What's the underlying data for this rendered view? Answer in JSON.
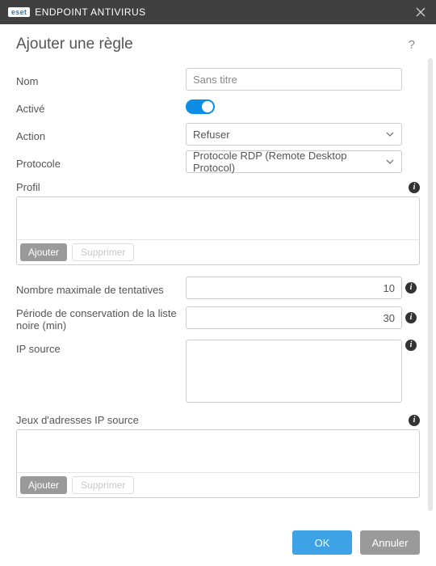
{
  "titlebar": {
    "brand": "eset",
    "title": "ENDPOINT ANTIVIRUS"
  },
  "header": {
    "page_title": "Ajouter une règle",
    "help_symbol": "?"
  },
  "form": {
    "name": {
      "label": "Nom",
      "placeholder": "Sans titre",
      "value": ""
    },
    "enabled": {
      "label": "Activé",
      "value": true
    },
    "action": {
      "label": "Action",
      "selected": "Refuser"
    },
    "protocol": {
      "label": "Protocole",
      "selected": "Protocole RDP (Remote Desktop Protocol)"
    },
    "profile": {
      "label": "Profil",
      "add": "Ajouter",
      "remove": "Supprimer"
    },
    "max_attempts": {
      "label": "Nombre maximale de tentatives",
      "value": "10"
    },
    "blacklist_period": {
      "label": "Période de conservation de la liste noire (min)",
      "value": "30"
    },
    "ip_source": {
      "label": "IP source"
    },
    "ip_sets": {
      "label": "Jeux d'adresses IP source",
      "add": "Ajouter",
      "remove": "Supprimer"
    }
  },
  "footer": {
    "ok": "OK",
    "cancel": "Annuler"
  }
}
